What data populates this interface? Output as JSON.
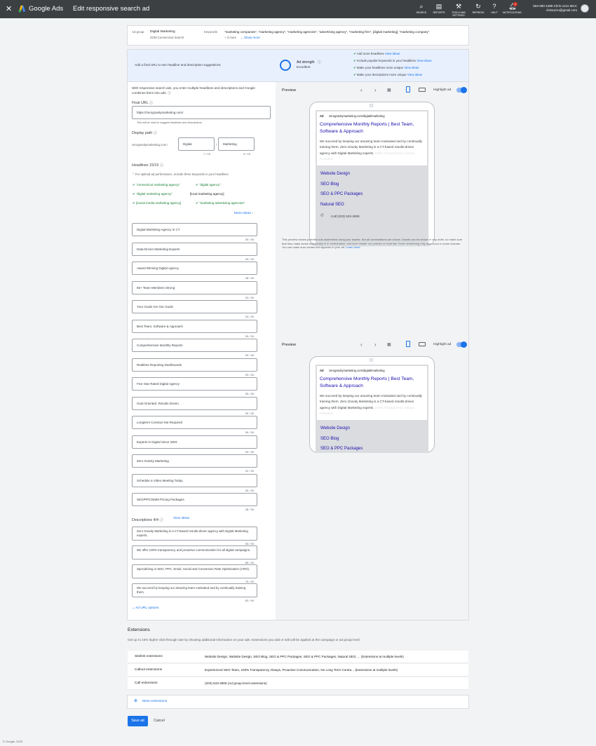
{
  "header": {
    "brand": "Google Ads",
    "page_title": "Edit responsive search ad",
    "tools": [
      "SEARCH",
      "REPORTS",
      "TOOLS AND SETTINGS",
      "REFRESH",
      "HELP",
      "NOTIFICATIONS"
    ],
    "notification_count": "1",
    "account_line1": "504-090-1398 Chris Uzzo MCC",
    "account_line2": "chrisuzzo@gmail.com"
  },
  "adgroup": {
    "label": "Ad group",
    "name": "Digital Marketing",
    "sub": "ZGM Connecticut Search",
    "kw_label": "Keywords",
    "keywords": "\"marketing companies\", \"marketing agency\", \"marketing agencies\", \"advertising agency\", \"marketing firm\", [digital marketing], \"marketing company\"",
    "more": "+ 3 more",
    "show_more": "Show more"
  },
  "strength": {
    "hint": "Add a final URL to see headline and description suggestions",
    "title": "Ad strength",
    "value": "Excellent",
    "tips": [
      {
        "text": "Add more headlines",
        "link": "View ideas"
      },
      {
        "text": "Include popular keywords in your headlines",
        "link": "View ideas"
      },
      {
        "text": "Make your headlines more unique",
        "link": "View ideas"
      },
      {
        "text": "Make your descriptions more unique",
        "link": "View ideas"
      }
    ]
  },
  "form": {
    "intro": "With responsive search ads, you enter multiple headlines and descriptions and Google combines them into ads.",
    "final_url_label": "Final URL",
    "final_url": "https://zerogravitymarketing.com/",
    "final_url_hint": "This will be used to suggest headlines and descriptions",
    "display_path_label": "Display path",
    "domain": "zerogravitymarketing.com /",
    "path1": "Digital",
    "path1_count": "7 / 15",
    "path2": "Marketing",
    "path2_count": "9 / 15",
    "headlines_label": "Headlines 15/15",
    "kw_hint": "For optimal ad performance, include three keywords in your headlines",
    "kw_chips": [
      {
        "text": "\"connecticut marketing agency\"",
        "ok": true
      },
      {
        "text": "\"digital agency\"",
        "ok": true
      },
      {
        "text": "\"digital marketing agency\"",
        "ok": true
      },
      {
        "text": "[local marketing agency]",
        "ok": false
      },
      {
        "text": "[social media marketing agency]",
        "ok": true
      },
      {
        "text": "\"marketing advertising agencies\"",
        "ok": true
      }
    ],
    "more_ideas": "More ideas",
    "headlines": [
      {
        "text": "Digital Marketing Agency in CT",
        "count": "30 / 30"
      },
      {
        "text": "Data-Driven Marketing Experts",
        "count": "29 / 30"
      },
      {
        "text": "Award Winning Digital Agency",
        "count": "28 / 30"
      },
      {
        "text": "65+ Team Members Strong",
        "count": "23 / 30"
      },
      {
        "text": "Your Goals Are Our Goals",
        "count": "24 / 30"
      },
      {
        "text": "Best Team, Software & Approach",
        "count": "30 / 30"
      },
      {
        "text": "Comprehensive Monthly Reports",
        "count": "29 / 30"
      },
      {
        "text": "Realtime Reporting Dashboards",
        "count": "29 / 30"
      },
      {
        "text": "Five Star Rated Digital Agency",
        "count": "30 / 30"
      },
      {
        "text": "Goal Oriented. Results Driven.",
        "count": "30 / 30"
      },
      {
        "text": "Longterm Contract Not Required",
        "count": "30 / 30"
      },
      {
        "text": "Experts in Digital Since 2003",
        "count": "29 / 30"
      },
      {
        "text": "Zero Gravity Marketing",
        "count": "22 / 30"
      },
      {
        "text": "Schedule a Video Meeting Today",
        "count": "30 / 30"
      },
      {
        "text": "SEO/PPC/SMM Pricing Packages",
        "count": "28 / 30"
      }
    ],
    "descriptions_label": "Descriptions 4/4",
    "desc_view_ideas": "View ideas",
    "descriptions": [
      {
        "text": "Zero Gravity Marketing is a CT-based results-driven agency with Digital Marketing experts.",
        "count": "90 / 90"
      },
      {
        "text": "We offer 100% transparency and proactive communication for all digital campaigns.",
        "count": "85 / 90"
      },
      {
        "text": "Specializing in SEO, PPC, Email, Social and Conversion Rate Optimization (CRO).",
        "count": "79 / 90"
      },
      {
        "text": "We succeed by keeping our amazing team motivated and by continually training them.",
        "count": "82 / 90"
      }
    ],
    "url_options": "Ad URL options"
  },
  "preview": {
    "label": "Preview",
    "highlight": "Highlight ad",
    "ad_tag": "Ad",
    "display_url": "zerogravitymarketing.com/digital/marketing",
    "headline": "Comprehensive Monthly Reports | Best Team, Software & Approach",
    "description": "We succeed by keeping our amazing team motivated and by continually training them. Zero Gravity Marketing is a CT-based results-driven agency with Digital Marketing experts.",
    "faded": "100% Transparency Always. Proactive",
    "sitelinks": [
      "Website Design",
      "SEO Blog",
      "SEO & PPC Packages",
      "Natural SEO"
    ],
    "call": "Call (203) 533-2808",
    "disclaimer": "This preview shows potential ads assembled using your assets. Not all combinations are shown. Assets can be shown in any order, so make sure that they make sense individually or in combination, and don't violate our policies or local law. Some shortening may also occur in some formats. You can make sure certain text appears in your ad.",
    "learn_more": "Learn more"
  },
  "extensions": {
    "title": "Extensions",
    "sub": "Get up to 15% higher click-through rate by showing additional information on your ads. Extensions you add or edit will be applied at the campaign or ad group level.",
    "rows": [
      {
        "name": "Sitelink extensions",
        "value": "Website Design, Website Design, SEO Blog, SEO & PPC Packages, SEO & PPC Packages, Natural SEO, ...",
        "note": "(Extensions at multiple levels)"
      },
      {
        "name": "Callout extensions",
        "value": "Experienced SEO Team, 100% Transparency Always, Proactive Communication, No Long Term Contra...",
        "note": "(Extensions at multiple levels)"
      },
      {
        "name": "Call extensions",
        "value": "(203) 533-2808 (Ad group-level extensions)",
        "note": ""
      }
    ],
    "more": "More extensions"
  },
  "actions": {
    "save": "Save ad",
    "cancel": "Cancel"
  },
  "footer": "© Google, 2023",
  "colors": {
    "accent": "#1a73e8",
    "topbar": "#3c4043",
    "green": "#188038"
  }
}
